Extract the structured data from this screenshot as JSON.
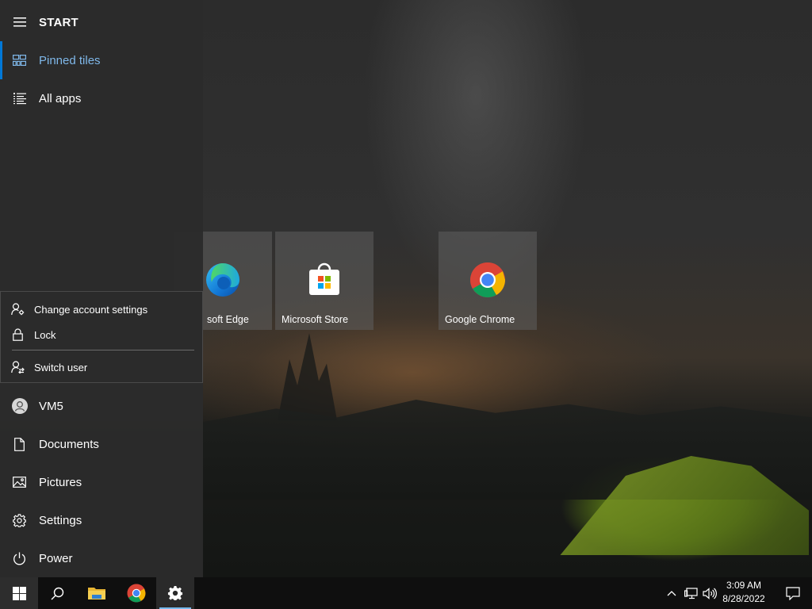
{
  "start_menu": {
    "header_label": "START",
    "nav": {
      "pinned_tiles": "Pinned tiles",
      "all_apps": "All apps"
    },
    "account_flyout": {
      "change_account_settings": "Change account settings",
      "lock": "Lock",
      "switch_user": "Switch user"
    },
    "bottom": {
      "user": "VM5",
      "documents": "Documents",
      "pictures": "Pictures",
      "settings": "Settings",
      "power": "Power"
    },
    "accent_color": "#0078d7"
  },
  "tiles": [
    {
      "label": "soft Edge",
      "icon": "edge-icon"
    },
    {
      "label": "Microsoft Store",
      "icon": "store-icon"
    },
    {
      "label": "Google Chrome",
      "icon": "chrome-icon"
    }
  ],
  "taskbar": {
    "icons": [
      "windows-start-icon",
      "search-icon",
      "file-explorer-icon",
      "chrome-icon",
      "settings-gear-icon"
    ],
    "tray_icons": [
      "chevron-up-icon",
      "network-icon",
      "volume-icon",
      "action-center-icon"
    ],
    "time": "3:09 AM",
    "date": "8/28/2022"
  }
}
